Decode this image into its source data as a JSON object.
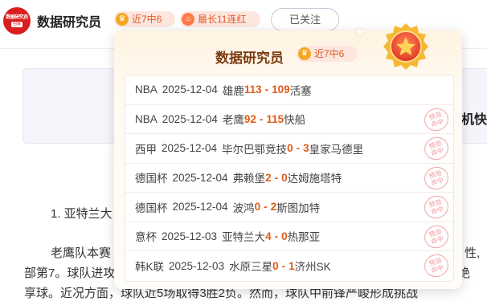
{
  "header": {
    "avatar_text_line1": "数据研究员",
    "avatar_text_line2": "招募",
    "author_name": "数据研究员",
    "badge_streak": "近7中6",
    "badge_longest": "最长11连红",
    "follow_button": "已关注",
    "badge_streak_icon": "crown-icon",
    "badge_longest_icon": "flame-icon"
  },
  "article": {
    "card_tail_text": "机快",
    "list_item": "1. 亚特兰大",
    "para_line1_left": "老鹰队本赛",
    "para_line1_right": "性,",
    "para_line2_left": "部第7。球队进攻",
    "para_line2_right": "绝",
    "para_line3_left": "享球。近况方面，球队近5场取得3胜2负。然而，球队中前锋严峻形成挑战",
    "para_line3_right": "战"
  },
  "popup": {
    "title": "数据研究员",
    "badge": "近7中6",
    "medal_icon": "star-medal-icon",
    "stamp_line1": "预测",
    "stamp_line2": "命中",
    "rows": [
      {
        "league": "NBA",
        "date": "2025-12-04",
        "home": "雄鹿",
        "home_score": "113",
        "away_score": "109",
        "away": "活塞",
        "hit": false
      },
      {
        "league": "NBA",
        "date": "2025-12-04",
        "home": "老鹰",
        "home_score": "92",
        "away_score": "115",
        "away": "快船",
        "hit": true
      },
      {
        "league": "西甲",
        "date": "2025-12-04",
        "home": "毕尔巴鄂竞技",
        "home_score": "0",
        "away_score": "3",
        "away": "皇家马德里",
        "hit": true
      },
      {
        "league": "德国杯",
        "date": "2025-12-04",
        "home": "弗赖堡",
        "home_score": "2",
        "away_score": "0",
        "away": "达姆施塔特",
        "hit": true
      },
      {
        "league": "德国杯",
        "date": "2025-12-04",
        "home": "波鸿",
        "home_score": "0",
        "away_score": "2",
        "away": "斯图加特",
        "hit": true
      },
      {
        "league": "意杯",
        "date": "2025-12-03",
        "home": "亚特兰大",
        "home_score": "4",
        "away_score": "0",
        "away": "热那亚",
        "hit": true
      },
      {
        "league": "韩K联",
        "date": "2025-12-03",
        "home": "水原三星",
        "home_score": "0",
        "away_score": "1",
        "away": "济州SK",
        "hit": true
      }
    ]
  },
  "colors": {
    "accent_orange": "#e05a1a",
    "badge_bg": "#fde6de",
    "stamp_red": "#f09a9a"
  }
}
